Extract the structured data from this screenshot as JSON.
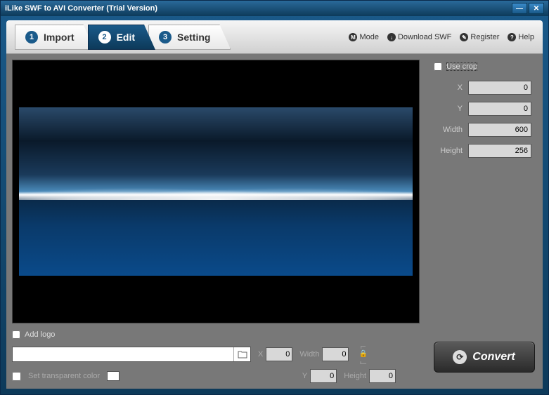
{
  "title": "iLike SWF to AVI Converter (Trial Version)",
  "tabs": {
    "import": {
      "num": "1",
      "label": "Import"
    },
    "edit": {
      "num": "2",
      "label": "Edit"
    },
    "setting": {
      "num": "3",
      "label": "Setting"
    }
  },
  "toolbar": {
    "mode": {
      "icon": "M",
      "label": "Mode"
    },
    "download": {
      "icon": "↓",
      "label": "Download SWF"
    },
    "register": {
      "icon": "✎",
      "label": "Register"
    },
    "help": {
      "icon": "?",
      "label": "Help"
    }
  },
  "crop": {
    "use_crop_label": "Use crop",
    "use_crop_checked": false,
    "x_label": "X",
    "x_value": "0",
    "y_label": "Y",
    "y_value": "0",
    "width_label": "Width",
    "width_value": "600",
    "height_label": "Height",
    "height_value": "256"
  },
  "logo": {
    "add_logo_label": "Add logo",
    "add_logo_checked": false,
    "path": "",
    "x_label": "X",
    "x_value": "0",
    "y_label": "Y",
    "y_value": "0",
    "width_label": "Width",
    "width_value": "0",
    "height_label": "Height",
    "height_value": "0",
    "transparent_label": "Set transparent color"
  },
  "convert": {
    "label": "Convert"
  },
  "window_controls": {
    "minimize": "—",
    "close": "✕"
  }
}
